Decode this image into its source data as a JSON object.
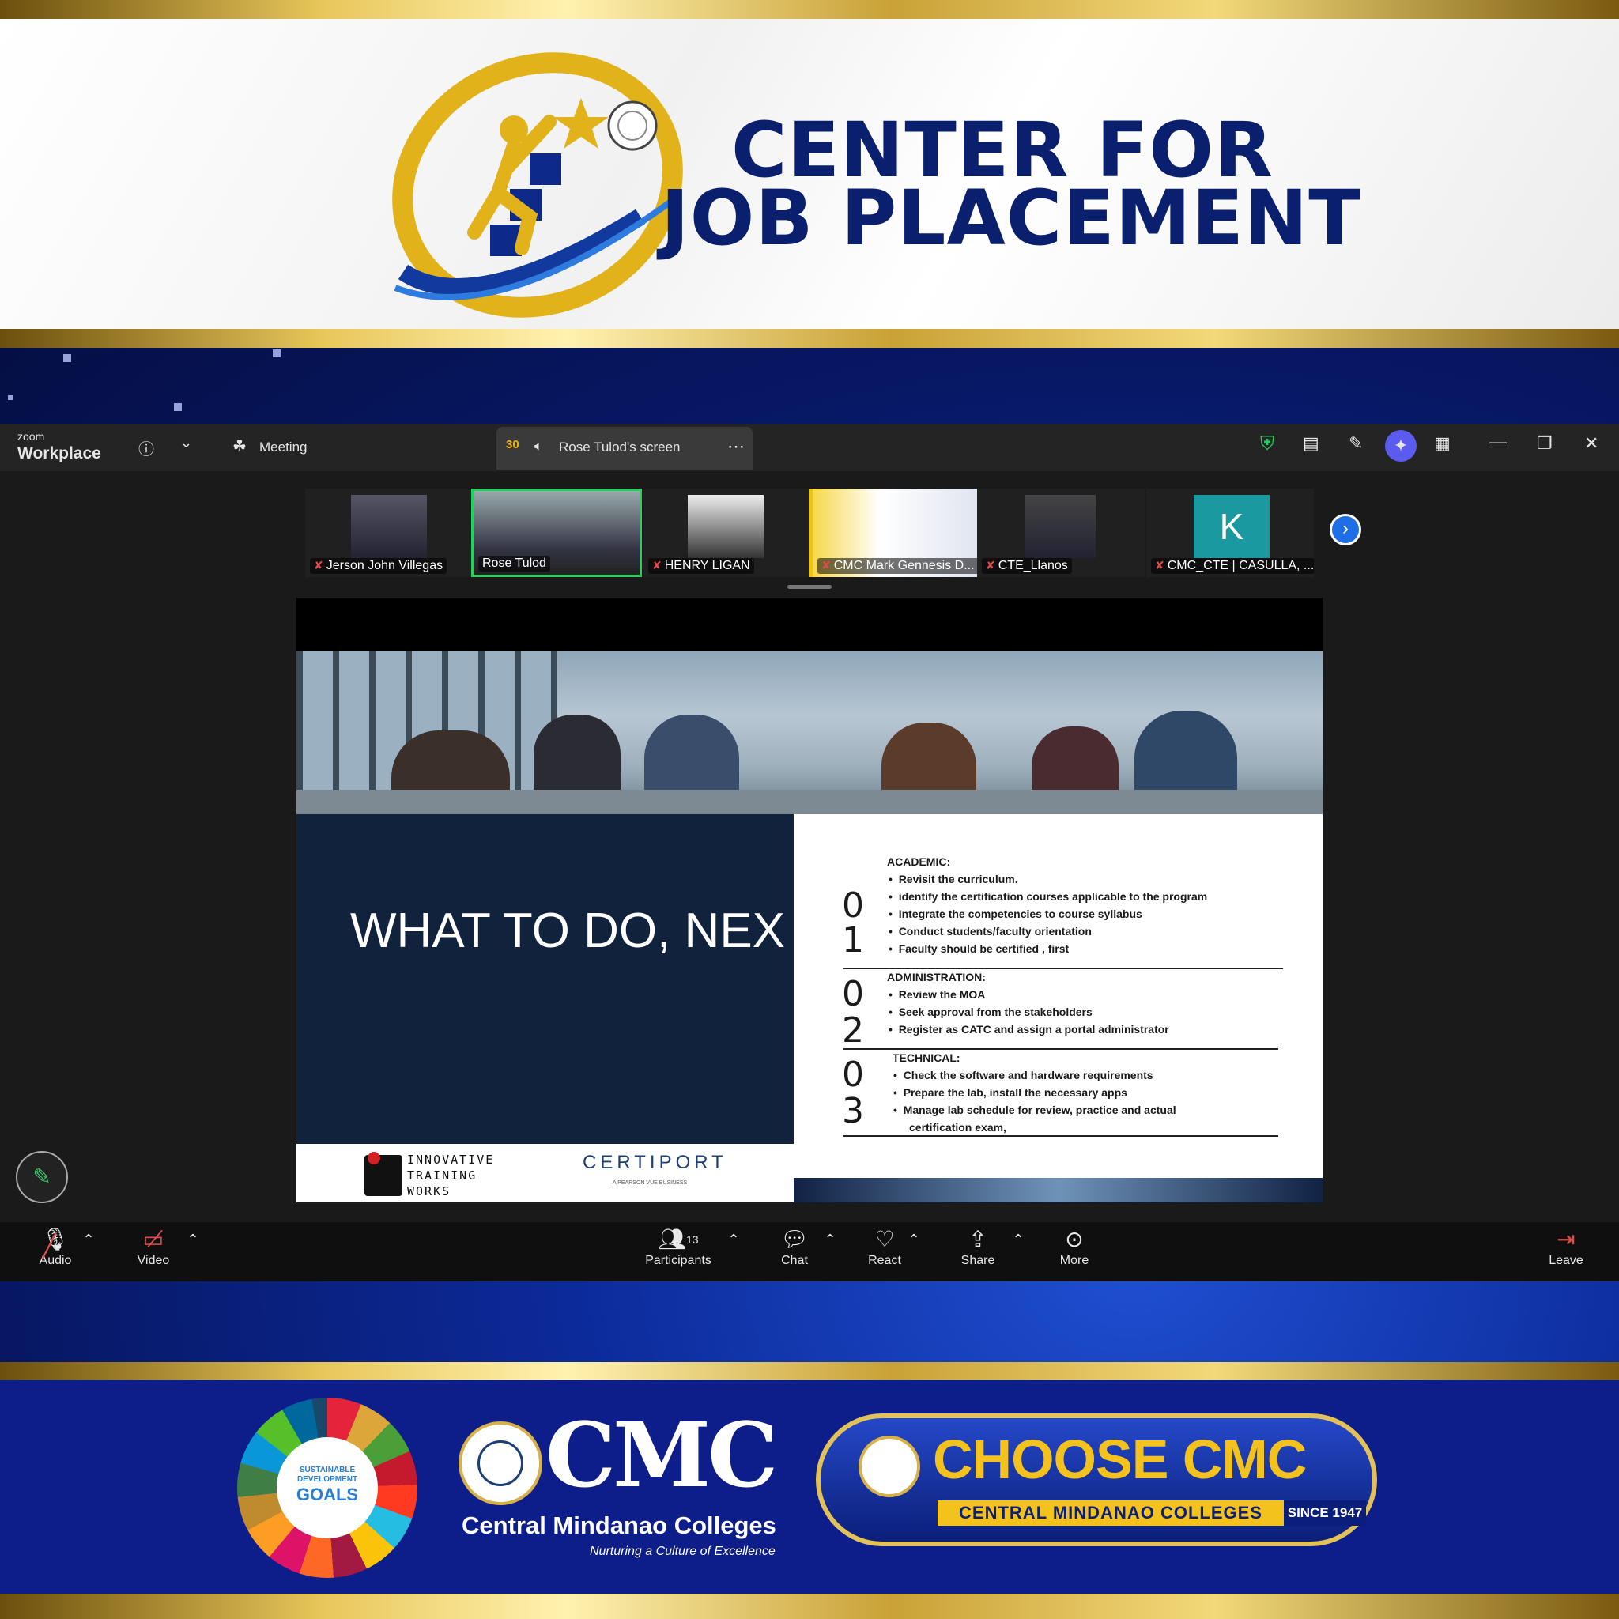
{
  "header": {
    "title_line1": "CENTER FOR",
    "title_line2": "JOB PLACEMENT",
    "badge_text": "CENTER FOR JOB PLACEMENT"
  },
  "zoom": {
    "brand_small": "zoom",
    "brand_big": "Workplace",
    "meeting_label": "Meeting",
    "screen_tab_label": "Rose Tulod's screen",
    "participants": [
      {
        "name": "Jerson John Villegas",
        "muted": true
      },
      {
        "name": "Rose Tulod",
        "muted": false,
        "active": true
      },
      {
        "name": "HENRY LIGAN",
        "muted": true
      },
      {
        "name": "CMC Mark Gennesis D...",
        "muted": true
      },
      {
        "name": "CTE_Llanos",
        "muted": true
      },
      {
        "name": "CMC_CTE | CASULLA, ...",
        "muted": true,
        "initial": "K"
      }
    ],
    "toolbar": {
      "audio": "Audio",
      "video": "Video",
      "participants": "Participants",
      "participants_count": "13",
      "chat": "Chat",
      "react": "React",
      "share": "Share",
      "more": "More",
      "leave": "Leave"
    }
  },
  "slide": {
    "title": "WHAT TO DO, NEX",
    "logo_itw_line1": "INNOVATIVE",
    "logo_itw_line2": "TRAINING",
    "logo_itw_line3": "WORKS",
    "logo_certiport": "CERTIPORT",
    "logo_certiport_sub": "A PEARSON VUE BUSINESS",
    "sections": [
      {
        "label": "ACADEMIC:",
        "num_top": "0",
        "num_bottom": "1",
        "items": [
          "Revisit the curriculum.",
          "identify the certification courses applicable to the program",
          "Integrate the competencies to course syllabus",
          "Conduct students/faculty  orientation",
          "Faculty should be certified , first"
        ]
      },
      {
        "label": "ADMINISTRATION:",
        "num_top": "0",
        "num_bottom": "2",
        "items": [
          "Review the MOA",
          "Seek approval from the stakeholders",
          "Register as CATC and assign a portal administrator"
        ]
      },
      {
        "label": "TECHNICAL:",
        "num_top": "0",
        "num_bottom": "3",
        "items": [
          "Check the software and hardware requirements",
          "Prepare the lab, install the necessary apps",
          "Manage lab schedule for review, practice and actual",
          "certification exam,"
        ]
      }
    ]
  },
  "footer": {
    "sdg_line1": "SUSTAINABLE",
    "sdg_line2": "DEVELOPMENT",
    "sdg_line3": "GOALS",
    "cmc_big": "CMC",
    "cmc_name": "Central Mindanao Colleges",
    "cmc_tagline": "Nurturing a Culture of Excellence",
    "choose": "CHOOSE CMC",
    "choose_sub": "CENTRAL MINDANAO COLLEGES",
    "since": "SINCE 1947"
  },
  "colors": {
    "navy": "#0a1f6e",
    "gold": "#e8c75a",
    "zoom_green": "#23d160",
    "slide_navy": "#11223d"
  }
}
